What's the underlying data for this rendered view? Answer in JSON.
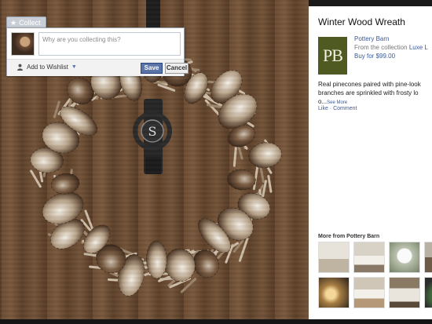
{
  "collect": {
    "tab_label": "Collect",
    "question_placeholder": "Why are you collecting this?",
    "wishlist_label": "Add to Wishlist",
    "save_label": "Save",
    "cancel_label": "Cancel"
  },
  "photo": {
    "monogram": "S"
  },
  "product": {
    "title": "Winter Wood Wreath",
    "logo_text": "PB",
    "brand": "Pottery Barn",
    "from_prefix": "From the collection",
    "collection": "Luxe L",
    "buy": "Buy for $99.00",
    "description": "Real pinecones paired with pine-look branches are sprinkled with frosty lo",
    "description_tail": "o...",
    "see_more": "See More",
    "like": "Like",
    "comment": "Comment"
  },
  "more_from": {
    "heading": "More from Pottery Barn",
    "thumbnails": [
      "stockings-thumb",
      "bedroom-thumb",
      "owl-thumb",
      "bench-thumb",
      "lanterns-thumb",
      "bed-thumb",
      "sofa-thumb",
      "tree-thumb"
    ]
  },
  "colors": {
    "fb_blue": "#3b5998",
    "button_blue": "#5b74a8",
    "logo_green": "#4e5a22",
    "wood": "#6a4b32"
  }
}
